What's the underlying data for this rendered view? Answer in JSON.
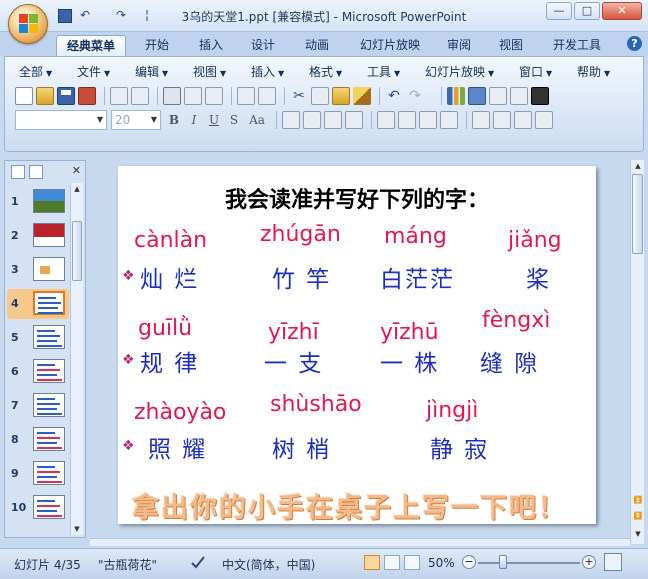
{
  "window": {
    "title": "3乌的天堂1.ppt [兼容模式] - Microsoft PowerPoint",
    "minimize": "—",
    "maximize": "□",
    "close": "✕"
  },
  "qat": {
    "undo": "↶",
    "redo": "↷",
    "more": "¦"
  },
  "ribbon_tabs": [
    "经典菜单",
    "开始",
    "插入",
    "设计",
    "动画",
    "幻灯片放映",
    "审阅",
    "视图",
    "开发工具"
  ],
  "help": "?",
  "menu": [
    "全部",
    "文件",
    "编辑",
    "视图",
    "插入",
    "格式",
    "工具",
    "幻灯片放映",
    "窗口",
    "帮助"
  ],
  "toolbar": {
    "font_size": "20"
  },
  "format_buttons": [
    "B",
    "I",
    "U",
    "S",
    "Aa"
  ],
  "thumbnails": [
    {
      "num": "1",
      "active": false
    },
    {
      "num": "2",
      "active": false
    },
    {
      "num": "3",
      "active": false
    },
    {
      "num": "4",
      "active": true
    },
    {
      "num": "5",
      "active": false
    },
    {
      "num": "6",
      "active": false
    },
    {
      "num": "7",
      "active": false
    },
    {
      "num": "8",
      "active": false
    },
    {
      "num": "9",
      "active": false
    },
    {
      "num": "10",
      "active": false
    }
  ],
  "slide": {
    "title": "我会读准并写好下列的字：",
    "rows": [
      {
        "items": [
          {
            "pinyin": "cànlàn",
            "hanzi": "灿 烂"
          },
          {
            "pinyin": "zhúgān",
            "hanzi": "竹 竿"
          },
          {
            "pinyin": "máng",
            "hanzi": "白茫茫"
          },
          {
            "pinyin": "jiǎng",
            "hanzi": "桨"
          }
        ]
      },
      {
        "items": [
          {
            "pinyin": "guīlǜ",
            "hanzi": "规 律"
          },
          {
            "pinyin": "yīzhī",
            "hanzi": "一 支"
          },
          {
            "pinyin": "yīzhū",
            "hanzi": "一 株"
          },
          {
            "pinyin": "fèngxì",
            "hanzi": "缝 隙"
          }
        ]
      },
      {
        "items": [
          {
            "pinyin": "zhàoyào",
            "hanzi": "照 耀"
          },
          {
            "pinyin": "shùshāo",
            "hanzi": "树   梢"
          },
          {
            "pinyin": "jìngjì",
            "hanzi": "静 寂"
          }
        ]
      }
    ],
    "bullet": "❖",
    "slogan": "拿出你的小手在桌子上写一下吧！"
  },
  "status": {
    "slide_info": "幻灯片 4/35",
    "theme": "\"古瓶荷花\"",
    "language": "中文(简体，中国)",
    "zoom": "50%",
    "zoom_level": 0.5
  },
  "colors": {
    "pinyin": "#e2194f",
    "hanzi": "#1b2fbd",
    "slogan": "#f2b98a"
  }
}
